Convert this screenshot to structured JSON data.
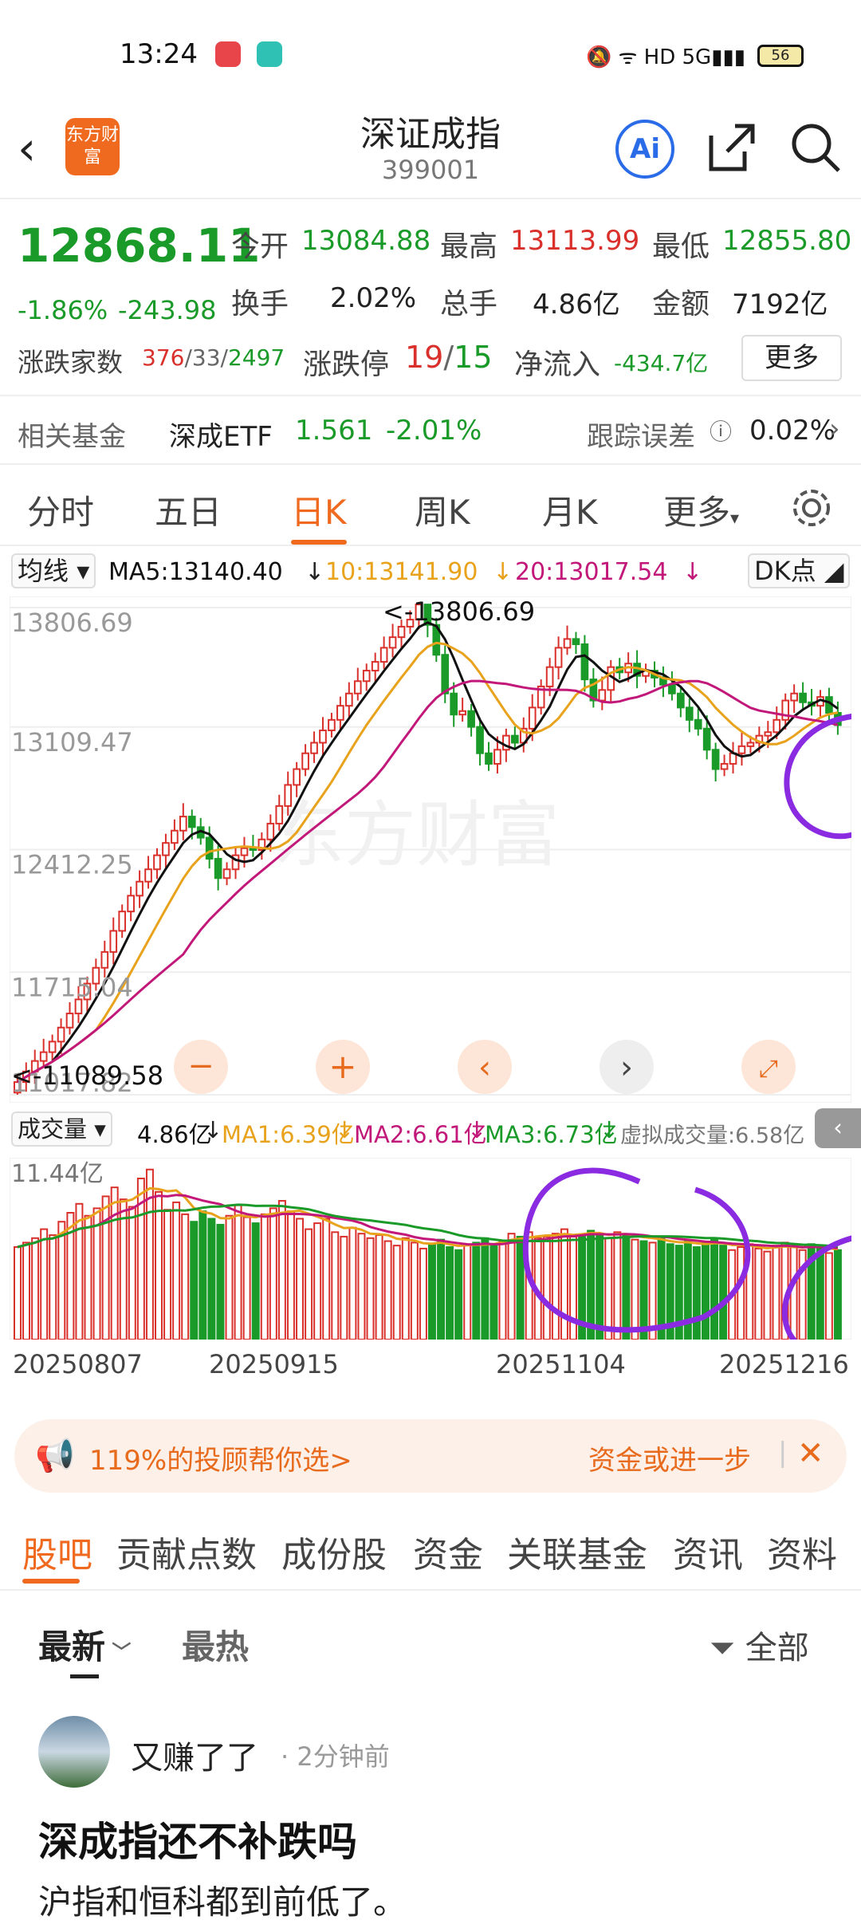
{
  "status": {
    "time": "13:24",
    "battery": "56",
    "network": "5G"
  },
  "header": {
    "title": "深证成指",
    "code": "399001",
    "logo_text": "东方财富",
    "ai_label": "Ai"
  },
  "quote": {
    "price": "12868.11",
    "change_pct": "-1.86%",
    "change": "-243.98",
    "open_label": "今开",
    "open": "13084.88",
    "high_label": "最高",
    "high": "13113.99",
    "low_label": "最低",
    "low": "12855.80",
    "turnover_label": "换手",
    "turnover": "2.02%",
    "volume_label": "总手",
    "volume": "4.86亿",
    "amount_label": "金额",
    "amount": "7192亿",
    "breadth_label": "涨跌家数",
    "breadth_up": "376",
    "breadth_flat": "33",
    "breadth_down": "2497",
    "limit_label": "涨跌停",
    "limit_up": "19",
    "limit_down": "15",
    "netflow_label": "净流入",
    "netflow": "-434.7亿",
    "more": "更多"
  },
  "fund": {
    "label": "相关基金",
    "name": "深成ETF",
    "price": "1.561",
    "pct": "-2.01%",
    "track_label": "跟踪误差",
    "track": "0.02%"
  },
  "tabs": [
    "分时",
    "五日",
    "日K",
    "周K",
    "月K",
    "更多"
  ],
  "kline_bar": {
    "selector": "均线",
    "ma5": "MA5:13140.40",
    "ma10": "10:13141.90",
    "ma20": "20:13017.54",
    "dk": "DK点"
  },
  "chart_data": {
    "type": "candlestick",
    "y_ticks": [
      "13806.69",
      "13109.47",
      "12412.25",
      "11715.04",
      "11017.82"
    ],
    "annotations": {
      "high": "<-13806.69",
      "low": "<-11089.58"
    },
    "watermark": "东方财富",
    "ylim": [
      11017.82,
      13806.69
    ],
    "closes": [
      11090,
      11150,
      11210,
      11260,
      11320,
      11400,
      11480,
      11560,
      11650,
      11740,
      11830,
      11950,
      12060,
      12150,
      12230,
      12300,
      12380,
      12450,
      12520,
      12600,
      12540,
      12480,
      12360,
      12250,
      12300,
      12380,
      12420,
      12410,
      12470,
      12560,
      12660,
      12780,
      12870,
      12960,
      13020,
      13090,
      13150,
      13230,
      13300,
      13370,
      13430,
      13480,
      13560,
      13620,
      13680,
      13720,
      13806,
      13690,
      13520,
      13300,
      13180,
      13200,
      13110,
      12960,
      12900,
      12980,
      13060,
      13020,
      13100,
      13220,
      13340,
      13450,
      13560,
      13610,
      13580,
      13380,
      13260,
      13320,
      13450,
      13420,
      13470,
      13400,
      13430,
      13390,
      13350,
      13300,
      13220,
      13150,
      13100,
      12980,
      12870,
      12900,
      12960,
      13000,
      13020,
      13060,
      13080,
      13150,
      13260,
      13300,
      13250,
      13230,
      13280,
      13190,
      13120
    ],
    "ma5": "MA5:13140.40",
    "ma10": "MA10:13141.90",
    "ma20": "MA20:13017.54"
  },
  "volume": {
    "selector": "成交量",
    "value": "4.86亿",
    "ma1": "MA1:6.39亿",
    "ma2": "MA2:6.61亿",
    "ma3": "MA3:6.73亿",
    "virtual": "虚拟成交量:6.58亿",
    "top_tick": "11.44亿"
  },
  "vol_chart_data": {
    "type": "bar",
    "ylim": [
      0,
      11.44
    ],
    "values": [
      6.2,
      6.5,
      6.8,
      7.4,
      7.0,
      7.9,
      8.5,
      9.1,
      8.3,
      8.8,
      9.6,
      10.2,
      9.4,
      8.9,
      10.8,
      11.4,
      9.9,
      8.7,
      9.2,
      8.4,
      7.9,
      8.6,
      8.1,
      7.7,
      8.3,
      9.0,
      8.2,
      7.8,
      8.4,
      8.8,
      9.3,
      8.6,
      8.1,
      7.4,
      7.8,
      8.1,
      7.2,
      6.9,
      7.5,
      7.1,
      6.8,
      7.0,
      6.6,
      6.3,
      6.8,
      6.5,
      6.1,
      6.4,
      6.7,
      6.2,
      6.0,
      6.3,
      6.5,
      6.8,
      6.4,
      6.6,
      7.1,
      6.9,
      7.2,
      6.8,
      6.9,
      7.1,
      7.4,
      6.9,
      7.0,
      7.3,
      7.1,
      6.8,
      7.2,
      7.0,
      6.7,
      6.6,
      6.5,
      6.8,
      6.4,
      6.3,
      6.6,
      6.2,
      6.5,
      6.7,
      6.3,
      6.0,
      6.2,
      6.4,
      6.1,
      5.9,
      6.3,
      6.5,
      6.2,
      6.0,
      6.4,
      6.1,
      5.8,
      6.0
    ]
  },
  "dates": [
    "20250807",
    "20250915",
    "20251104",
    "20251216"
  ],
  "banner": {
    "text": "119%的投顾帮你选>",
    "right": "资金或进一步"
  },
  "bottom_tabs": [
    "股吧",
    "贡献点数",
    "成份股",
    "资金",
    "关联基金",
    "资讯",
    "资料"
  ],
  "sort": {
    "latest": "最新",
    "hot": "最热",
    "filter": "全部"
  },
  "post": {
    "user": "又赚了了",
    "time": "· 2分钟前",
    "title": "深成指还不补跌吗",
    "body": "沪指和恒科都到前低了。"
  },
  "colors": {
    "up": "#d9302b",
    "down": "#1a9a28",
    "accent": "#ef6a1f",
    "ma5": "#111111",
    "ma10": "#e8a21c",
    "ma20": "#c2187a"
  }
}
